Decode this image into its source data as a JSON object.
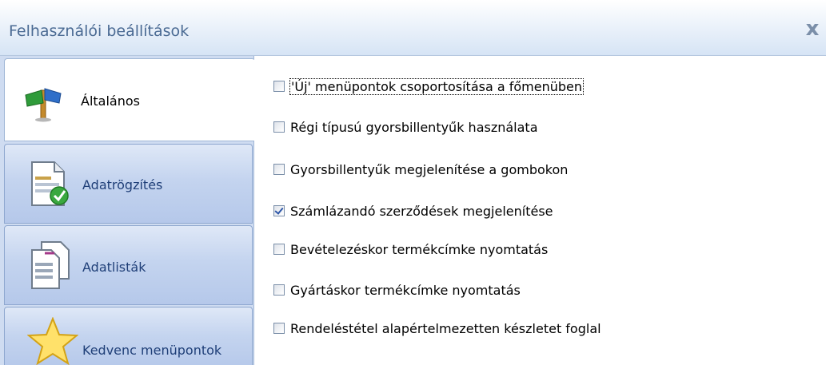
{
  "window": {
    "title": "Felhasználói beállítások",
    "close_glyph": "x"
  },
  "tabs": [
    {
      "label": "Általános",
      "icon": "signpost-icon",
      "active": true
    },
    {
      "label": "Adatrögzítés",
      "icon": "document-check-icon",
      "active": false
    },
    {
      "label": "Adatlisták",
      "icon": "documents-icon",
      "active": false
    },
    {
      "label": "Kedvenc menüpontok",
      "icon": "star-icon",
      "active": false
    }
  ],
  "options": [
    {
      "label": "'Új' menüpontok csoportosítása a főmenüben",
      "checked": false,
      "focused": true
    },
    {
      "label": "Régi típusú gyorsbillentyűk használata",
      "checked": false
    },
    {
      "label": "Gyorsbillentyűk megjelenítése a gombokon",
      "checked": false
    },
    {
      "label": "Számlázandó szerződések megjelenítése",
      "checked": true
    },
    {
      "label": "Bevételezéskor termékcímke nyomtatás",
      "checked": false
    },
    {
      "label": "Gyártáskor termékcímke nyomtatás",
      "checked": false
    },
    {
      "label": "Rendeléstétel alapértelmezetten készletet foglal",
      "checked": false
    }
  ],
  "colors": {
    "accent": "#1f3f78",
    "tab_bg": "#cfdcf1",
    "title_text": "#4a6a93"
  }
}
